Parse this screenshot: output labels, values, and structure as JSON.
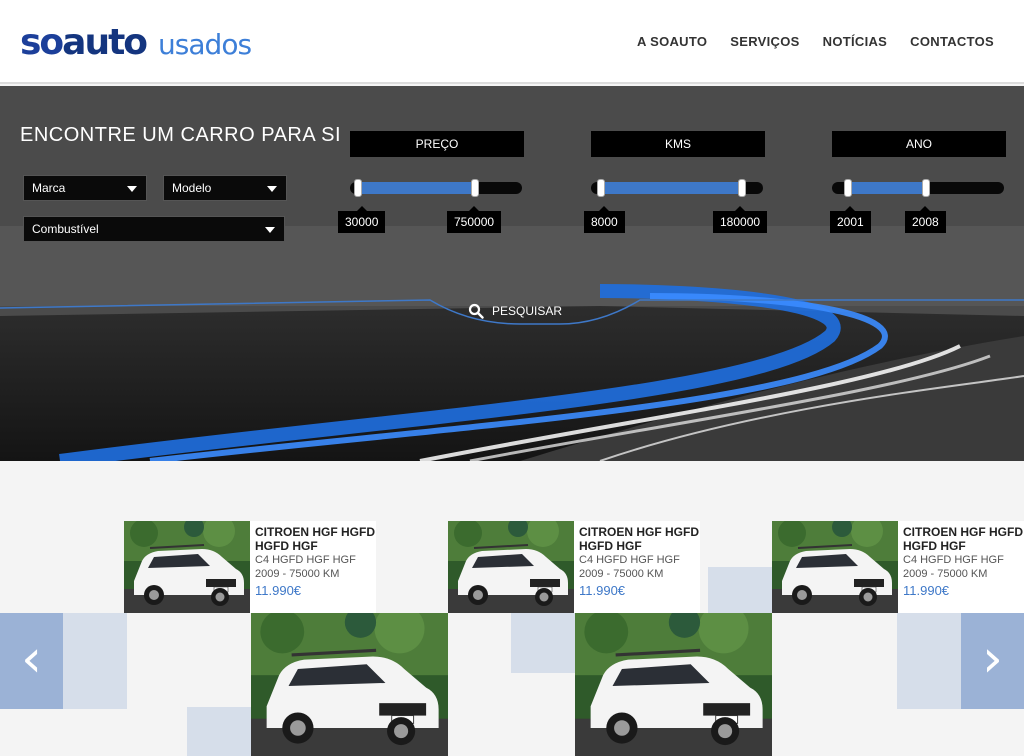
{
  "header": {
    "logo_so": "SO",
    "logo_auto": "auto",
    "logo_usados": "usados",
    "nav": [
      "A SOAUTO",
      "SERVIÇOS",
      "NOTÍCIAS",
      "CONTACTOS"
    ]
  },
  "hero": {
    "title": "ENCONTRE UM CARRO PARA SI",
    "selects": {
      "marca": "Marca",
      "modelo": "Modelo",
      "combustivel": "Combustível"
    },
    "filters": [
      {
        "label": "PREÇO",
        "min": "30000",
        "max": "750000"
      },
      {
        "label": "KMS",
        "min": "8000",
        "max": "180000"
      },
      {
        "label": "ANO",
        "min": "2001",
        "max": "2008"
      }
    ],
    "search_label": "PESQUISAR"
  },
  "listings": [
    {
      "title": "CITROEN HGF HGFD HGFD HGF",
      "subtitle": "C4 HGFD HGF HGF",
      "meta": "2009 - 75000 KM",
      "price": "11.990€"
    },
    {
      "title": "CITROEN HGF HGFD HGFD HGF",
      "subtitle": "C4 HGFD HGF HGF",
      "meta": "2009 - 75000 KM",
      "price": "11.990€"
    },
    {
      "title": "CITROEN HGF HGFD HGFD HGF",
      "subtitle": "C4 HGFD HGF HGF",
      "meta": "2009 - 75000 KM",
      "price": "11.990€"
    }
  ],
  "carousel": {
    "prev_glyph": "‹",
    "next_glyph": "›"
  },
  "colors": {
    "brand_dark": "#14357f",
    "brand_light": "#3d7fd8",
    "accent_blue": "#3e78c8",
    "tile": "#d6deea"
  }
}
